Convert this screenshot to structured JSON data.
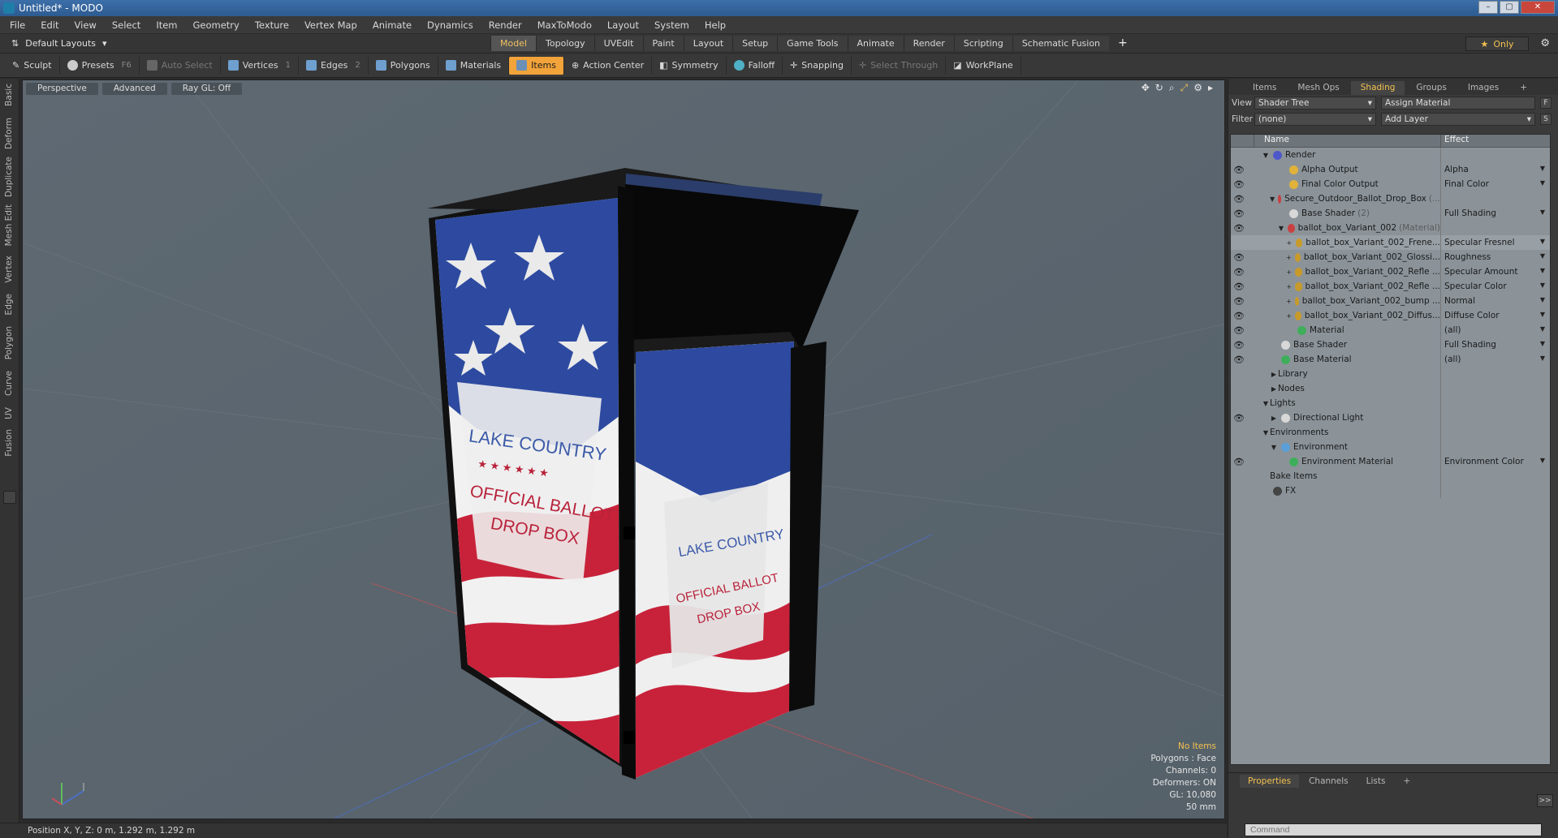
{
  "window": {
    "title": "Untitled* - MODO"
  },
  "menu": [
    "File",
    "Edit",
    "View",
    "Select",
    "Item",
    "Geometry",
    "Texture",
    "Vertex Map",
    "Animate",
    "Dynamics",
    "Render",
    "MaxToModo",
    "Layout",
    "System",
    "Help"
  ],
  "layout": {
    "selector": "Default Layouts",
    "tabs": [
      "Model",
      "Topology",
      "UVEdit",
      "Paint",
      "Layout",
      "Setup",
      "Game Tools",
      "Animate",
      "Render",
      "Scripting",
      "Schematic Fusion"
    ],
    "active_tab": "Model",
    "only": "Only"
  },
  "toolbar": {
    "sculpt": "Sculpt",
    "presets": "Presets",
    "presets_key": "F6",
    "auto_select": "Auto Select",
    "vertices": "Vertices",
    "vertices_key": "1",
    "edges": "Edges",
    "edges_key": "2",
    "polygons": "Polygons",
    "materials": "Materials",
    "items": "Items",
    "action_center": "Action Center",
    "symmetry": "Symmetry",
    "falloff": "Falloff",
    "snapping": "Snapping",
    "select_through": "Select Through",
    "workplane": "WorkPlane"
  },
  "left_strip": [
    "Basic",
    "Deform",
    "Duplicate",
    "Mesh Edit",
    "Vertex",
    "Edge",
    "Polygon",
    "Curve",
    "UV",
    "Fusion"
  ],
  "viewport": {
    "perspective": "Perspective",
    "advanced": "Advanced",
    "raygl": "Ray GL: Off",
    "model_text": {
      "side_line1": "LAKE COUNTRY",
      "side_line2": "OFFICIAL BALLOT",
      "side_line3": "DROP BOX",
      "front_line1": "LAKE COUNTRY",
      "front_line2": "OFFICIAL BALLOT",
      "front_line3": "DROP BOX",
      "stars": "★ ★ ★ ★ ★ ★"
    },
    "stats": {
      "no_items": "No Items",
      "polygons": "Polygons : Face",
      "channels": "Channels: 0",
      "deformers": "Deformers: ON",
      "gl": "GL: 10,080",
      "focal": "50 mm"
    }
  },
  "status": {
    "position": "Position X, Y, Z:  0 m, 1.292 m, 1.292 m"
  },
  "right_panel": {
    "tabs": [
      "Items",
      "Mesh Ops",
      "Shading",
      "Groups",
      "Images"
    ],
    "active_tab": "Shading",
    "view_label": "View",
    "view_value": "Shader Tree",
    "assign_material": "Assign Material",
    "filter_label": "Filter",
    "filter_value": "(none)",
    "add_layer": "Add Layer",
    "f_btn": "F",
    "s_btn": "S",
    "col_name": "Name",
    "col_effect": "Effect",
    "rows": [
      {
        "name": "Render",
        "effect": "",
        "hint": "",
        "indent": 1,
        "arrow": "▼",
        "color": "#4d58c9",
        "eye": false
      },
      {
        "name": "Alpha Output",
        "effect": "Alpha",
        "hint": "",
        "indent": 3,
        "arrow": "",
        "color": "#e0b23a",
        "eye": true
      },
      {
        "name": "Final Color Output",
        "effect": "Final Color",
        "hint": "",
        "indent": 3,
        "arrow": "",
        "color": "#e0b23a",
        "eye": true
      },
      {
        "name": "Secure_Outdoor_Ballot_Drop_Box",
        "effect": "",
        "hint": "(...",
        "indent": 2,
        "arrow": "▼",
        "color": "#c84040",
        "eye": true
      },
      {
        "name": "Base Shader",
        "effect": "Full Shading",
        "hint": "(2)",
        "indent": 3,
        "arrow": "",
        "color": "#d8d8d8",
        "eye": true
      },
      {
        "name": "ballot_box_Variant_002",
        "effect": "",
        "hint": "(Material)",
        "indent": 3,
        "arrow": "▼",
        "color": "#c84040",
        "eye": true
      },
      {
        "name": "ballot_box_Variant_002_Frene...",
        "effect": "Specular Fresnel",
        "hint": "",
        "indent": 4,
        "arrow": "+",
        "color": "#c89a2a",
        "eye": false
      },
      {
        "name": "ballot_box_Variant_002_Glossi...",
        "effect": "Roughness",
        "hint": "",
        "indent": 4,
        "arrow": "+",
        "color": "#c89a2a",
        "eye": true
      },
      {
        "name": "ballot_box_Variant_002_Refle ...",
        "effect": "Specular Amount",
        "hint": "",
        "indent": 4,
        "arrow": "+",
        "color": "#c89a2a",
        "eye": true
      },
      {
        "name": "ballot_box_Variant_002_Refle ...",
        "effect": "Specular Color",
        "hint": "",
        "indent": 4,
        "arrow": "+",
        "color": "#c89a2a",
        "eye": true
      },
      {
        "name": "ballot_box_Variant_002_bump ...",
        "effect": "Normal",
        "hint": "",
        "indent": 4,
        "arrow": "+",
        "color": "#c89a2a",
        "eye": true
      },
      {
        "name": "ballot_box_Variant_002_Diffus...",
        "effect": "Diffuse Color",
        "hint": "",
        "indent": 4,
        "arrow": "+",
        "color": "#c89a2a",
        "eye": true
      },
      {
        "name": "Material",
        "effect": "(all)",
        "hint": "",
        "indent": 4,
        "arrow": "",
        "color": "#3fae5a",
        "eye": true
      },
      {
        "name": "Base Shader",
        "effect": "Full Shading",
        "hint": "",
        "indent": 2,
        "arrow": "",
        "color": "#d8d8d8",
        "eye": true
      },
      {
        "name": "Base Material",
        "effect": "(all)",
        "hint": "",
        "indent": 2,
        "arrow": "",
        "color": "#3fae5a",
        "eye": true
      },
      {
        "name": "Library",
        "effect": "",
        "hint": "",
        "indent": 2,
        "arrow": "▶",
        "color": "",
        "eye": false
      },
      {
        "name": "Nodes",
        "effect": "",
        "hint": "",
        "indent": 2,
        "arrow": "▶",
        "color": "",
        "eye": false
      },
      {
        "name": "Lights",
        "effect": "",
        "hint": "",
        "indent": 1,
        "arrow": "▼",
        "color": "",
        "eye": false
      },
      {
        "name": "Directional Light",
        "effect": "",
        "hint": "",
        "indent": 2,
        "arrow": "▶",
        "color": "#d8d8d8",
        "eye": true
      },
      {
        "name": "Environments",
        "effect": "",
        "hint": "",
        "indent": 1,
        "arrow": "▼",
        "color": "",
        "eye": false
      },
      {
        "name": "Environment",
        "effect": "",
        "hint": "",
        "indent": 2,
        "arrow": "▼",
        "color": "#5a9fd8",
        "eye": false
      },
      {
        "name": "Environment Material",
        "effect": "Environment Color",
        "hint": "",
        "indent": 3,
        "arrow": "",
        "color": "#3fae5a",
        "eye": true
      },
      {
        "name": "Bake Items",
        "effect": "",
        "hint": "",
        "indent": 1,
        "arrow": "",
        "color": "",
        "eye": false
      },
      {
        "name": "FX",
        "effect": "",
        "hint": "",
        "indent": 1,
        "arrow": "",
        "color": "#444",
        "eye": false
      }
    ]
  },
  "bottom_panel": {
    "tabs": [
      "Properties",
      "Channels",
      "Lists"
    ],
    "active_tab": "Properties",
    "command_placeholder": "Command",
    "expand": ">>"
  },
  "colors": {
    "accent": "#f2c14e",
    "active_tool": "#f2a33a",
    "viewport_bg": "#5a656e"
  }
}
